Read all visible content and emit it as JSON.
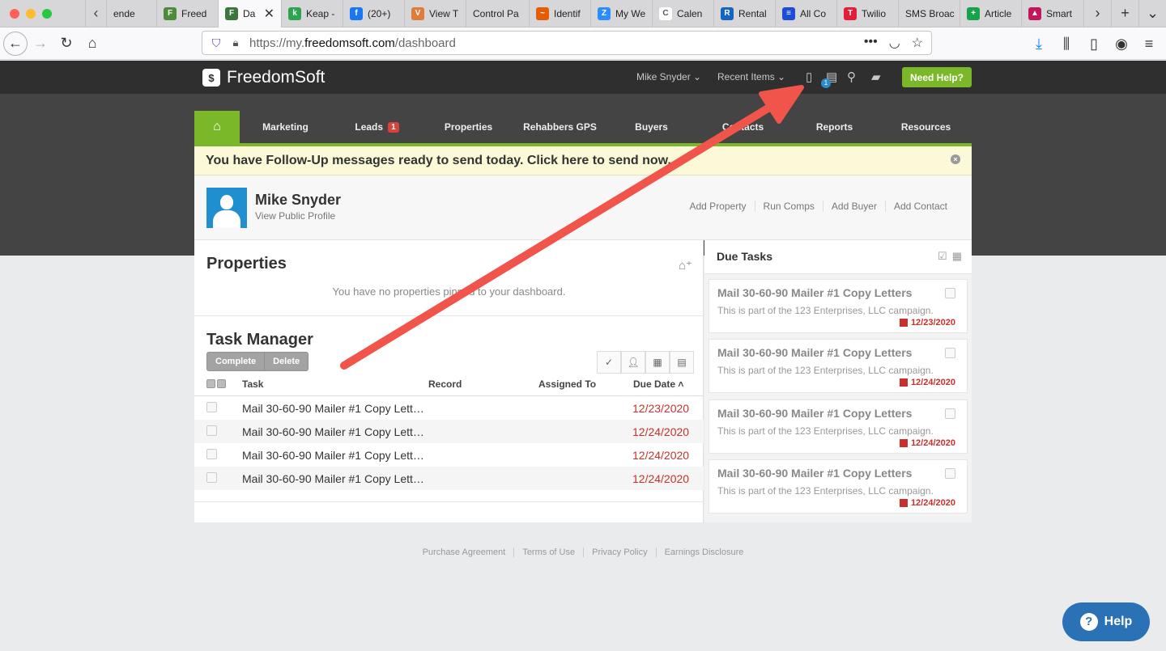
{
  "browser": {
    "tabs": [
      {
        "label": "ende",
        "color": "#e5e5e5",
        "glyph": ""
      },
      {
        "label": "Freed",
        "color": "#4b8b3b",
        "glyph": "F"
      },
      {
        "label": "Da",
        "color": "#3c763d",
        "glyph": "F",
        "active": true
      },
      {
        "label": "Keap -",
        "color": "#2da44e",
        "glyph": "k"
      },
      {
        "label": "(20+)",
        "color": "#1877f2",
        "glyph": "f"
      },
      {
        "label": "View T",
        "color": "#e07b39",
        "glyph": "V"
      },
      {
        "label": "Control Pa",
        "color": "#d7d7da",
        "glyph": ""
      },
      {
        "label": "Identif",
        "color": "#e65c00",
        "glyph": "~"
      },
      {
        "label": "My We",
        "color": "#2d8cff",
        "glyph": "Z"
      },
      {
        "label": "Calen",
        "color": "#ffffff",
        "glyph": "C"
      },
      {
        "label": "Rental",
        "color": "#1565c0",
        "glyph": "R"
      },
      {
        "label": "All Co",
        "color": "#1e4bd8",
        "glyph": "≡"
      },
      {
        "label": "Twilio",
        "color": "#e31e36",
        "glyph": "T"
      },
      {
        "label": "SMS Broac",
        "color": "#d7d7da",
        "glyph": ""
      },
      {
        "label": "Article",
        "color": "#16a34a",
        "glyph": "+"
      },
      {
        "label": "Smart",
        "color": "#c2185b",
        "glyph": "▲"
      }
    ],
    "url_prefix": "https://my.",
    "url_domain": "freedomsoft.com",
    "url_path": "/dashboard"
  },
  "header": {
    "logo_text": "FreedomSoft",
    "user_menu": "Mike Snyder",
    "recent_items": "Recent Items",
    "docs_badge": "1",
    "need_help": "Need Help?"
  },
  "tabs": {
    "marketing": "Marketing",
    "leads": "Leads",
    "leads_badge": "1",
    "properties": "Properties",
    "rehabbers": "Rehabbers GPS",
    "buyers": "Buyers",
    "contacts": "Contacts",
    "reports": "Reports",
    "resources": "Resources"
  },
  "banner": {
    "text": "You have Follow-Up messages ready to send today. Click here to send now."
  },
  "profile": {
    "name": "Mike Snyder",
    "link": "View Public Profile",
    "actions": [
      "Add Property",
      "Run Comps",
      "Add Buyer",
      "Add Contact"
    ]
  },
  "properties": {
    "title": "Properties",
    "empty": "You have no properties pinned to your dashboard."
  },
  "task_manager": {
    "title": "Task Manager",
    "complete": "Complete",
    "delete": "Delete",
    "columns": {
      "task": "Task",
      "record": "Record",
      "assigned": "Assigned To",
      "due": "Due Date ˄"
    },
    "rows": [
      {
        "task": "Mail 30-60-90 Mailer #1 Copy Lett…",
        "due": "12/23/2020"
      },
      {
        "task": "Mail 30-60-90 Mailer #1 Copy Lett…",
        "due": "12/24/2020"
      },
      {
        "task": "Mail 30-60-90 Mailer #1 Copy Lett…",
        "due": "12/24/2020"
      },
      {
        "task": "Mail 30-60-90 Mailer #1 Copy Lett…",
        "due": "12/24/2020"
      }
    ]
  },
  "due_tasks": {
    "title": "Due Tasks",
    "cards": [
      {
        "title": "Mail 30-60-90 Mailer #1 Copy Letters",
        "sub": "This is part of the 123 Enterprises, LLC campaign.",
        "date": "12/23/2020"
      },
      {
        "title": "Mail 30-60-90 Mailer #1 Copy Letters",
        "sub": "This is part of the 123 Enterprises, LLC campaign.",
        "date": "12/24/2020"
      },
      {
        "title": "Mail 30-60-90 Mailer #1 Copy Letters",
        "sub": "This is part of the 123 Enterprises, LLC campaign.",
        "date": "12/24/2020"
      },
      {
        "title": "Mail 30-60-90 Mailer #1 Copy Letters",
        "sub": "This is part of the 123 Enterprises, LLC campaign.",
        "date": "12/24/2020"
      }
    ]
  },
  "footer": [
    "Purchase Agreement",
    "Terms of Use",
    "Privacy Policy",
    "Earnings Disclosure"
  ],
  "help_widget": "Help",
  "colors": {
    "brand_green": "#7ab829",
    "due_red": "#c9302c",
    "help_blue": "#2b71b5"
  }
}
